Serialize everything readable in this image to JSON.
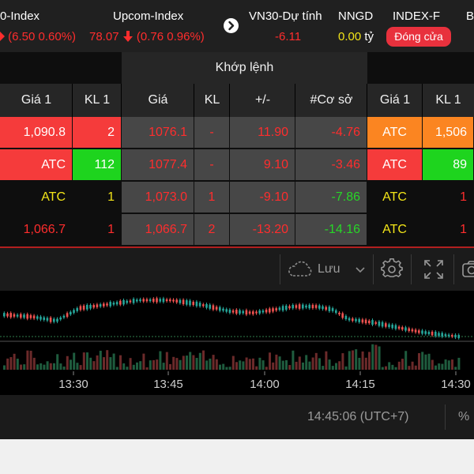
{
  "topbar": {
    "indices": [
      {
        "name": "0-Index",
        "value_parts": [
          "",
          "(6.50 0.60%)"
        ],
        "arrow": "up",
        "color": "red"
      },
      {
        "name": "Upcom-Index",
        "value_parts": [
          "78.07",
          "(0.76 0.96%)"
        ],
        "arrow": "down",
        "color": "red"
      },
      {
        "name": "VN30-Dự tính",
        "value": "-6.11",
        "color": "red"
      },
      {
        "name": "NNGD",
        "value": "0.00",
        "unit": "tỷ",
        "color": "yellow"
      },
      {
        "name": "INDEX-F",
        "pill": "Đóng cửa"
      },
      {
        "name": "B"
      }
    ]
  },
  "table": {
    "group_header": "Khớp lệnh",
    "columns": [
      "Giá 1",
      "KL 1",
      "Giá",
      "KL",
      "+/-",
      "#Cơ sở",
      "Giá 1",
      "KL 1"
    ],
    "rows": [
      {
        "bid_price": "1,090.8",
        "bid_vol": "2",
        "price": "1076.1",
        "vol": "-",
        "change": "11.90",
        "basis": "-4.76",
        "ask_price": "ATC",
        "ask_vol": "1,506",
        "styles": {
          "bid_price": "bg-red",
          "bid_vol": "bg-red",
          "price": "red",
          "vol": "red",
          "change": "red",
          "basis": "red",
          "ask_price": "bg-orange",
          "ask_vol": "bg-orange"
        }
      },
      {
        "bid_price": "ATC",
        "bid_vol": "112",
        "price": "1077.4",
        "vol": "-",
        "change": "9.10",
        "basis": "-3.46",
        "ask_price": "ATC",
        "ask_vol": "89",
        "styles": {
          "bid_price": "bg-red",
          "bid_vol": "bg-green",
          "price": "red",
          "vol": "red",
          "change": "red",
          "basis": "red",
          "ask_price": "bg-red",
          "ask_vol": "bg-green"
        }
      },
      {
        "bid_price": "ATC",
        "bid_vol": "1",
        "price": "1,073.0",
        "vol": "1",
        "change": "-9.10",
        "basis": "-7.86",
        "ask_price": "ATC",
        "ask_vol": "1",
        "styles": {
          "bid_price": "yellow",
          "bid_vol": "yellow",
          "price": "red",
          "vol": "red",
          "change": "red",
          "basis": "green",
          "ask_price": "yellow",
          "ask_vol": "red"
        }
      },
      {
        "bid_price": "1,066.7",
        "bid_vol": "1",
        "price": "1,066.7",
        "vol": "2",
        "change": "-13.20",
        "basis": "-14.16",
        "ask_price": "ATC",
        "ask_vol": "1",
        "styles": {
          "bid_price": "red",
          "bid_vol": "red",
          "price": "red",
          "vol": "red",
          "change": "red",
          "basis": "green",
          "ask_price": "yellow",
          "ask_vol": "red"
        }
      }
    ]
  },
  "toolbar": {
    "save_label": "Lưu",
    "icons": [
      "cloud-icon",
      "chevron-down-icon",
      "settings-gear-icon",
      "fullscreen-icon",
      "camera-icon"
    ]
  },
  "chart": {
    "time_labels": [
      "13:30",
      "13:45",
      "14:00",
      "14:15",
      "14:30"
    ],
    "colors": {
      "up": "#26a69a",
      "down": "#ef5350",
      "vol_up": "#1f5c3e",
      "vol_down": "#6b2a2a",
      "baseline": "#2f7d4a"
    }
  },
  "status": {
    "clock": "14:45:06 (UTC+7)",
    "pct": "%"
  }
}
